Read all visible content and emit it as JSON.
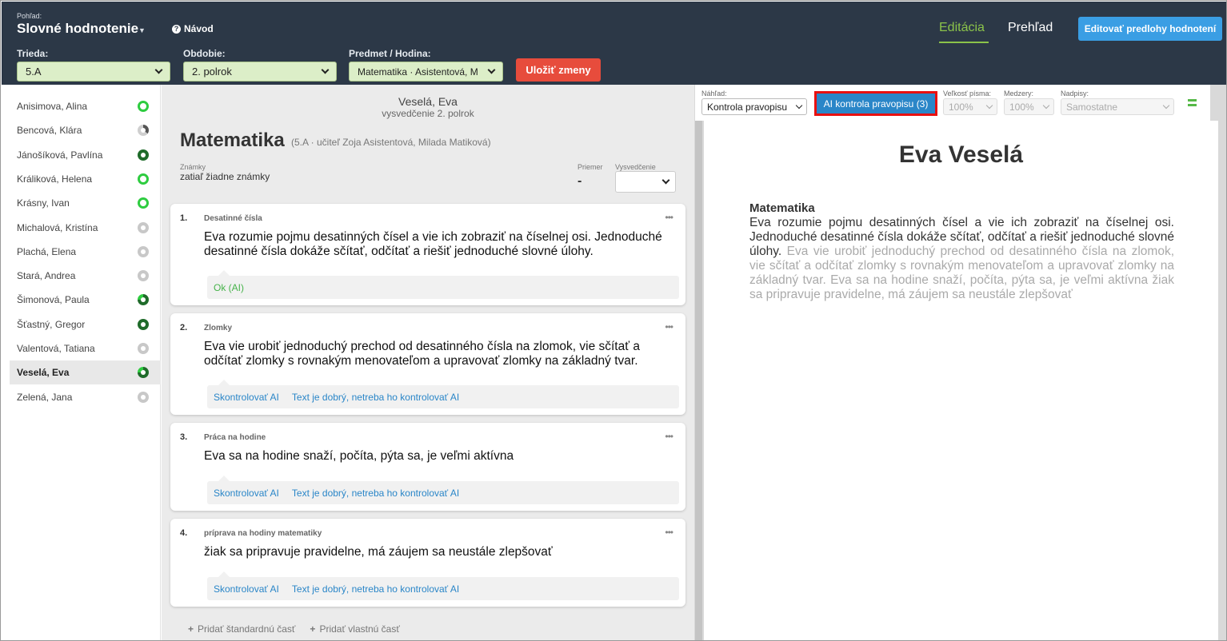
{
  "header": {
    "view_label": "Pohľad:",
    "view_value": "Slovné hodnotenie",
    "help_label": "Návod",
    "nav_edit": "Editácia",
    "nav_overview": "Prehľad",
    "templates_button": "Editovať predlohy hodnotení",
    "class_label": "Trieda:",
    "class_value": "5.A",
    "period_label": "Obdobie:",
    "period_value": "2. polrok",
    "subject_label": "Predmet / Hodina:",
    "subject_value": "Matematika · Asistentová, M",
    "save_button": "Uložiť zmeny"
  },
  "students": [
    {
      "name": "Anisimova, Alina",
      "status": "green"
    },
    {
      "name": "Bencová, Klára",
      "status": "pie"
    },
    {
      "name": "Jánošíková, Pavlína",
      "status": "dark"
    },
    {
      "name": "Králiková, Helena",
      "status": "green"
    },
    {
      "name": "Krásny, Ivan",
      "status": "green"
    },
    {
      "name": "Michalová, Kristína",
      "status": "grey"
    },
    {
      "name": "Plachá, Elena",
      "status": "grey"
    },
    {
      "name": "Stará, Andrea",
      "status": "grey"
    },
    {
      "name": "Šimonová, Paula",
      "status": "half"
    },
    {
      "name": "Šťastný, Gregor",
      "status": "dark"
    },
    {
      "name": "Valentová, Tatiana",
      "status": "grey"
    },
    {
      "name": "Veselá, Eva",
      "status": "half",
      "active": true
    },
    {
      "name": "Zelená, Jana",
      "status": "grey"
    }
  ],
  "middle": {
    "student_name": "Veselá, Eva",
    "certificate": "vysvedčenie 2. polrok",
    "subject": "Matematika",
    "meta": "(5.A · učiteľ Zoja Asistentová, Milada Matiková)",
    "grades_label": "Známky",
    "grades_value": "zatiaľ žiadne známky",
    "average_label": "Priemer",
    "average_value": "-",
    "cert_label": "Vysvedčenie",
    "cards": [
      {
        "num": "1.",
        "title": "Desatinné čísla",
        "text": "Eva rozumie pojmu desatinných čísel a vie ich zobraziť na číselnej osi. Jednoduché desatinné čísla dokáže sčítať, odčítať a riešiť jednoduché slovné úlohy.",
        "status": "Ok (AI)"
      },
      {
        "num": "2.",
        "title": "Zlomky",
        "text": "Eva vie urobiť jednoduchý prechod od desatinného čísla na zlomok, vie sčítať a odčítať zlomky s rovnakým menovateľom a upravovať zlomky na základný tvar.",
        "check": "Skontrolovať AI",
        "skip": "Text je dobrý, netreba ho kontrolovať AI"
      },
      {
        "num": "3.",
        "title": "Práca na hodine",
        "text": "Eva sa na hodine snaží, počíta, pýta sa, je veľmi aktívna",
        "check": "Skontrolovať AI",
        "skip": "Text je dobrý, netreba ho kontrolovať AI"
      },
      {
        "num": "4.",
        "title": "príprava na hodiny matematiky",
        "text": "žiak sa pripravuje pravidelne, má záujem sa neustále zlepšovať",
        "check": "Skontrolovať AI",
        "skip": "Text je dobrý, netreba ho kontrolovať AI"
      }
    ],
    "add_standard": "Pridať štandardnú časť",
    "add_custom": "Pridať vlastnú časť"
  },
  "toolbar": {
    "preview_label": "Náhľad:",
    "preview_value": "Kontrola pravopisu",
    "ai_button": "AI kontrola pravopisu (3)",
    "font_size_label": "Veľkosť písma:",
    "font_size_value": "100%",
    "spacing_label": "Medzery:",
    "spacing_value": "100%",
    "headings_label": "Nadpisy:",
    "headings_value": "Samostatne"
  },
  "preview": {
    "name": "Eva Veselá",
    "subject": "Matematika",
    "text_checked": "Eva rozumie pojmu desatinných čísel a vie ich zobraziť na číselnej osi. Jednoduché desatinné čísla dokáže sčítať, odčítať a riešiť jednoduché slovné úlohy.",
    "text_unchecked": "Eva vie urobiť jednoduchý prechod od desatinného čísla na zlomok, vie sčítať a odčítať zlomky s rovnakým menovateľom a upravovať zlomky na základný tvar. Eva sa na hodine snaží, počíta, pýta sa, je veľmi aktívna žiak sa pripravuje pravidelne, má záujem sa neustále zlepšovať"
  },
  "colors": {
    "header_bg": "#2c3847",
    "accent_green": "#8bc34a",
    "button_blue": "#3a9ee4",
    "save_red": "#e74c3c",
    "highlight_red": "#e81010"
  }
}
